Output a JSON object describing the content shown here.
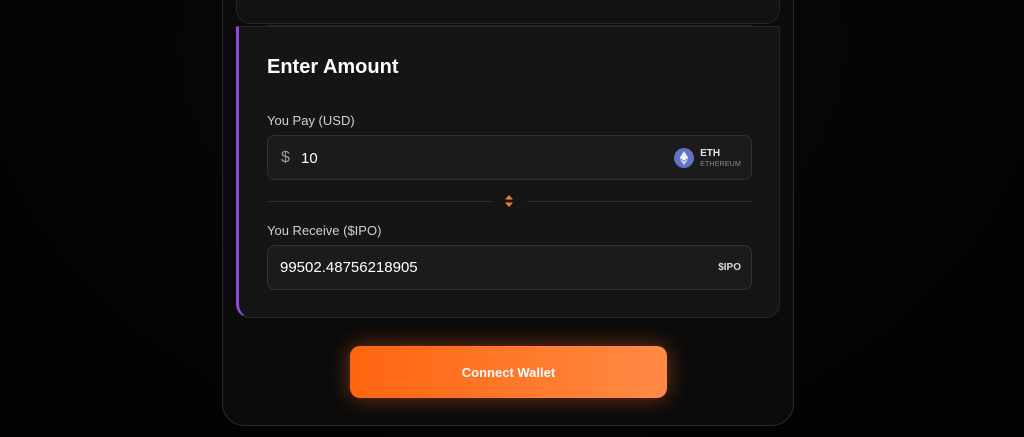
{
  "amount_card": {
    "title": "Enter Amount",
    "pay": {
      "label": "You Pay (USD)",
      "currency_symbol": "$",
      "value": "10",
      "token_symbol": "ETH",
      "token_name": "ETHEREUM",
      "token_icon": "ethereum-icon"
    },
    "swap_icon": "swap-arrows-icon",
    "receive": {
      "label": "You Receive ($IPO)",
      "value": "99502.48756218905",
      "token_symbol": "$IPO"
    }
  },
  "actions": {
    "connect_wallet_label": "Connect Wallet"
  },
  "colors": {
    "accent_purple": "#8b4fd6",
    "accent_orange": "#ff6a1a",
    "eth_blue": "#6273c4"
  }
}
